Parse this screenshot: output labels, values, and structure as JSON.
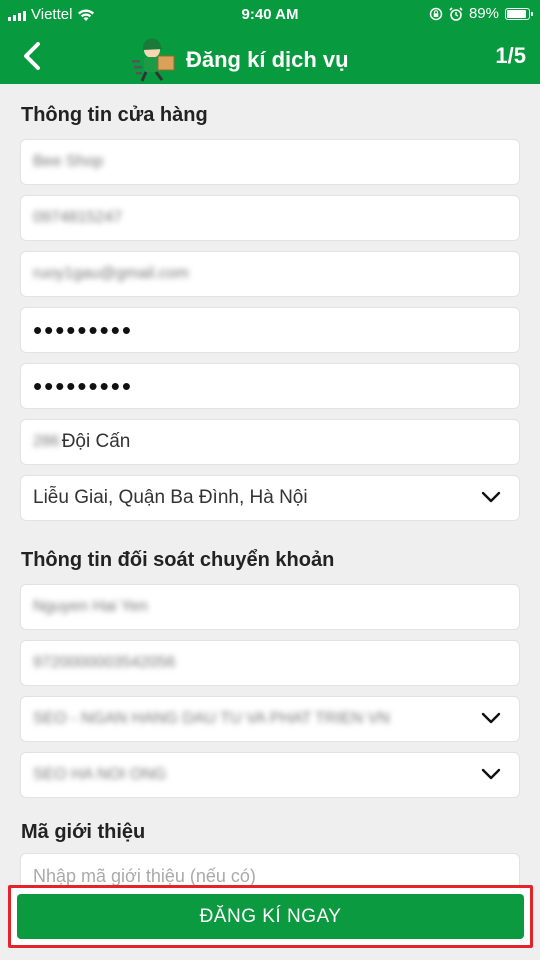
{
  "status": {
    "carrier": "Viettel",
    "time": "9:40 AM",
    "battery": "89%",
    "battery_level": 0.89
  },
  "header": {
    "title": "Đăng kí dịch vụ",
    "step": "1/5",
    "back_icon": "chevron-left-icon",
    "logo_icon": "delivery-man-icon"
  },
  "shop_section": {
    "title": "Thông tin cửa hàng",
    "shop_name": "Bee Shop",
    "phone": "0974815247",
    "email": "ruoy1gau@gmail.com",
    "password": "•••••••••",
    "confirm_password": "•••••••••",
    "address_number": "286",
    "address_street": "Đội Cấn",
    "area": "Liễu Giai, Quận Ba Đình, Hà Nội"
  },
  "bank_section": {
    "title": "Thông tin đối soát chuyển khoản",
    "account_name": "Nguyen Hai Yen",
    "account_number": "9720000003542056",
    "bank": "SEO - NGAN HANG DAU TU VA PHAT TRIEN VN",
    "branch": "SEO HA NOI ONG"
  },
  "referral_section": {
    "title": "Mã giới thiệu",
    "placeholder": "Nhập mã giới thiệu (nếu có)"
  },
  "submit": {
    "label": "ĐĂNG KÍ NGAY"
  },
  "colors": {
    "brand_green": "#089a3e",
    "button_green": "#0b9a3f",
    "highlight_red": "#e5232a"
  }
}
